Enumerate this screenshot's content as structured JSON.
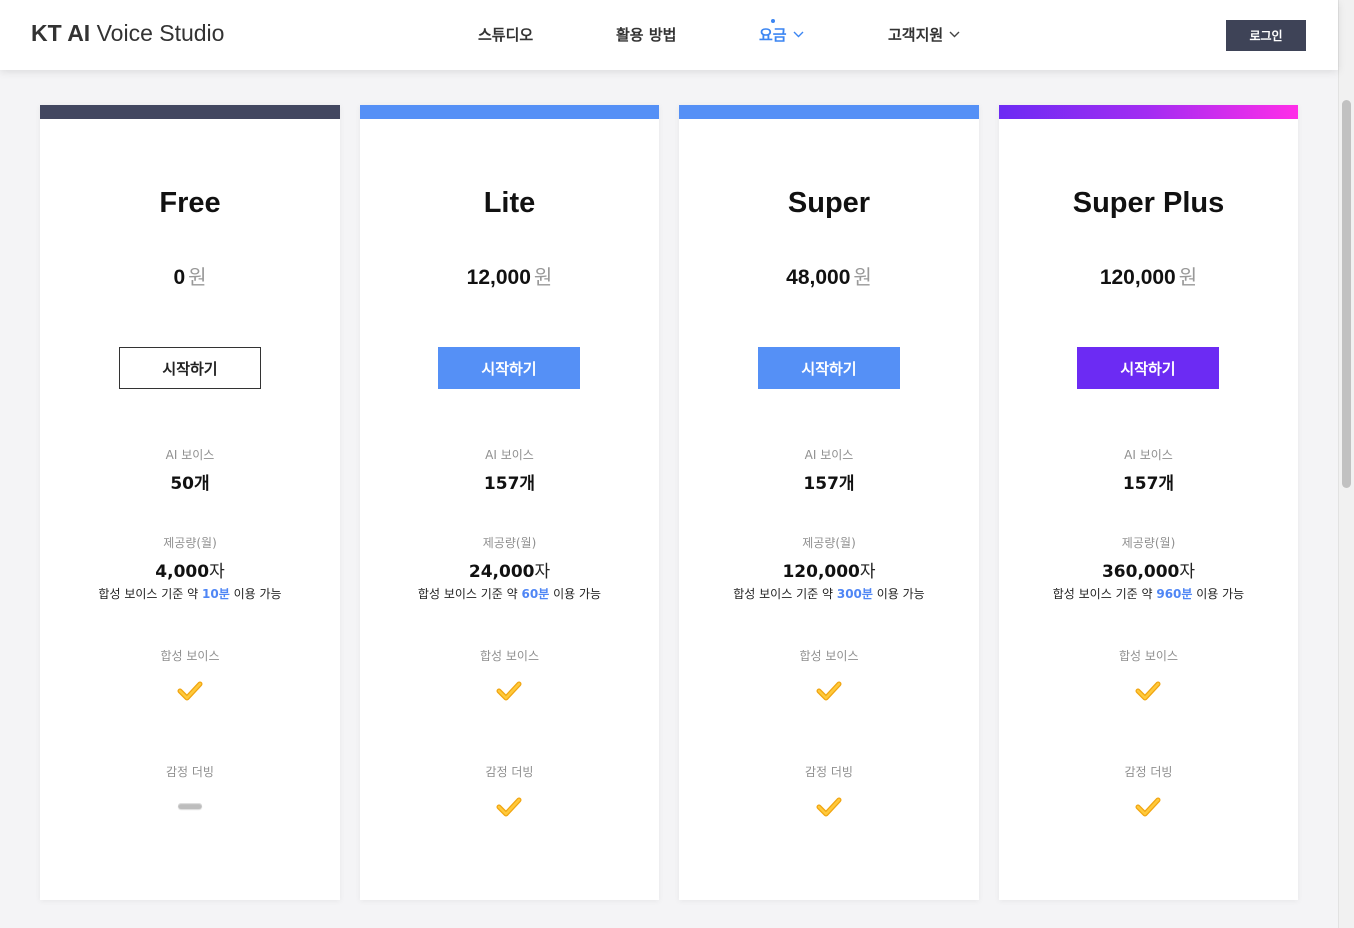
{
  "header": {
    "logo_bold": "KT AI",
    "logo_rest": " Voice Studio",
    "nav": {
      "studio": "스튜디오",
      "howto": "활용 방법",
      "pricing": "요금",
      "support": "고객지원"
    },
    "login_label": "로그인",
    "accent_color": "#3c86f2"
  },
  "labels": {
    "ai_voice": "AI 보이스",
    "monthly": "제공량(월)",
    "synth_voice": "합성 보이스",
    "emotion_dub": "감정 더빙",
    "note_prefix": "합성 보이스 기준 약 ",
    "note_suffix": " 이용 가능",
    "currency": "원",
    "voice_unit": "개",
    "char_unit": "자"
  },
  "plans": [
    {
      "name": "Free",
      "price": "0",
      "button": "시작하기",
      "voices": "50",
      "chars": "4,000",
      "minutes": "10분",
      "synth": "check",
      "emotion": "dash",
      "bar_color": "#424760",
      "button_color": "#ffffff"
    },
    {
      "name": "Lite",
      "price": "12,000",
      "button": "시작하기",
      "voices": "157",
      "chars": "24,000",
      "minutes": "60분",
      "synth": "check",
      "emotion": "check",
      "bar_color": "#5590f6",
      "button_color": "#5590f6"
    },
    {
      "name": "Super",
      "price": "48,000",
      "button": "시작하기",
      "voices": "157",
      "chars": "120,000",
      "minutes": "300분",
      "synth": "check",
      "emotion": "check",
      "bar_color": "#5590f6",
      "button_color": "#5590f6"
    },
    {
      "name": "Super Plus",
      "price": "120,000",
      "button": "시작하기",
      "voices": "157",
      "chars": "360,000",
      "minutes": "960분",
      "synth": "check",
      "emotion": "check",
      "bar_color": "#6c2bf3 → #ff2ee8",
      "button_color": "#6c2bf3"
    }
  ]
}
